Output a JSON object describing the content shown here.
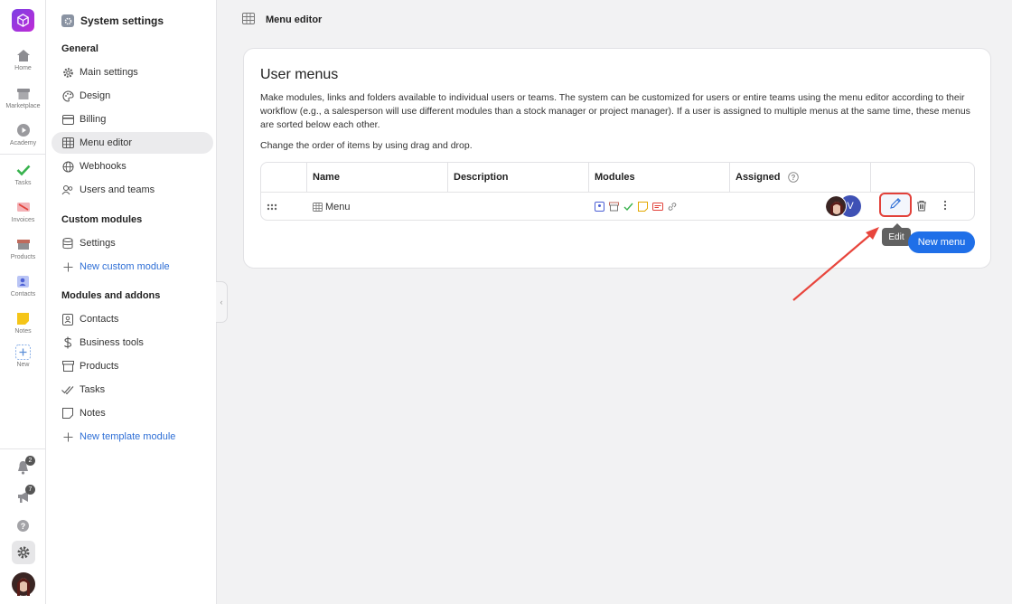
{
  "rail": {
    "items": [
      {
        "label": "Home",
        "icon": "home-icon"
      },
      {
        "label": "Marketplace",
        "icon": "store-icon"
      },
      {
        "label": "Academy",
        "icon": "play-icon"
      },
      {
        "label": "Tasks",
        "icon": "check-icon"
      },
      {
        "label": "Invoices",
        "icon": "invoice-icon"
      },
      {
        "label": "Products",
        "icon": "box-icon"
      },
      {
        "label": "Contacts",
        "icon": "contact-icon"
      },
      {
        "label": "Notes",
        "icon": "note-icon"
      },
      {
        "label": "New",
        "icon": "plus-icon"
      }
    ],
    "notifications_count": "2",
    "announcements_count": "7"
  },
  "sidebar": {
    "title": "System settings",
    "general_heading": "General",
    "general": [
      "Main settings",
      "Design",
      "Billing",
      "Menu editor",
      "Webhooks",
      "Users and teams"
    ],
    "custom_heading": "Custom modules",
    "custom": [
      "Settings",
      "New custom module"
    ],
    "addons_heading": "Modules and addons",
    "addons": [
      "Contacts",
      "Business tools",
      "Products",
      "Tasks",
      "Notes",
      "New template module"
    ]
  },
  "header": {
    "title": "Menu editor"
  },
  "card": {
    "title": "User menus",
    "description": "Make modules, links and folders available to individual users or teams. The system can be customized for users or entire teams using the menu editor according to their workflow (e.g., a salesperson will use different modules than a stock manager or project manager). If a user is assigned to multiple menus at the same time, these menus are sorted below each other.",
    "hint": "Change the order of items by using drag and drop.",
    "columns": [
      "Name",
      "Description",
      "Modules",
      "Assigned"
    ],
    "rows": [
      {
        "name": "Menu",
        "description": "",
        "avatar_letter": "V"
      }
    ],
    "tooltip": "Edit",
    "new_button": "New menu"
  },
  "colors": {
    "accent": "#1f6fe8",
    "highlight": "#e2413a",
    "brand": "#8e35e0"
  }
}
